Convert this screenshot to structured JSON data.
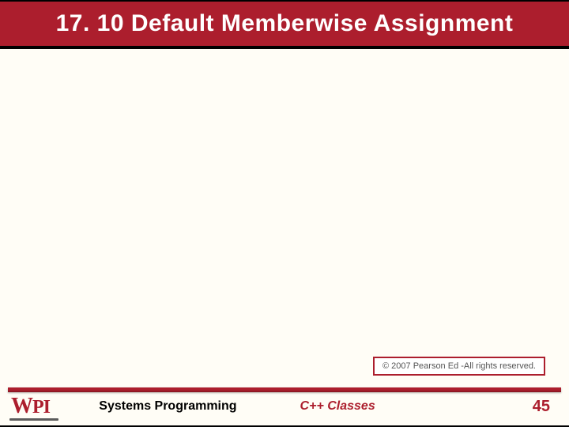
{
  "slide": {
    "title": "17. 10 Default Memberwise Assignment"
  },
  "copyright": "© 2007 Pearson Ed -All rights reserved.",
  "footer": {
    "logo": {
      "w": "W",
      "p": "P",
      "i": "I"
    },
    "course": "Systems Programming",
    "topic": "C++ Classes",
    "page": "45"
  }
}
